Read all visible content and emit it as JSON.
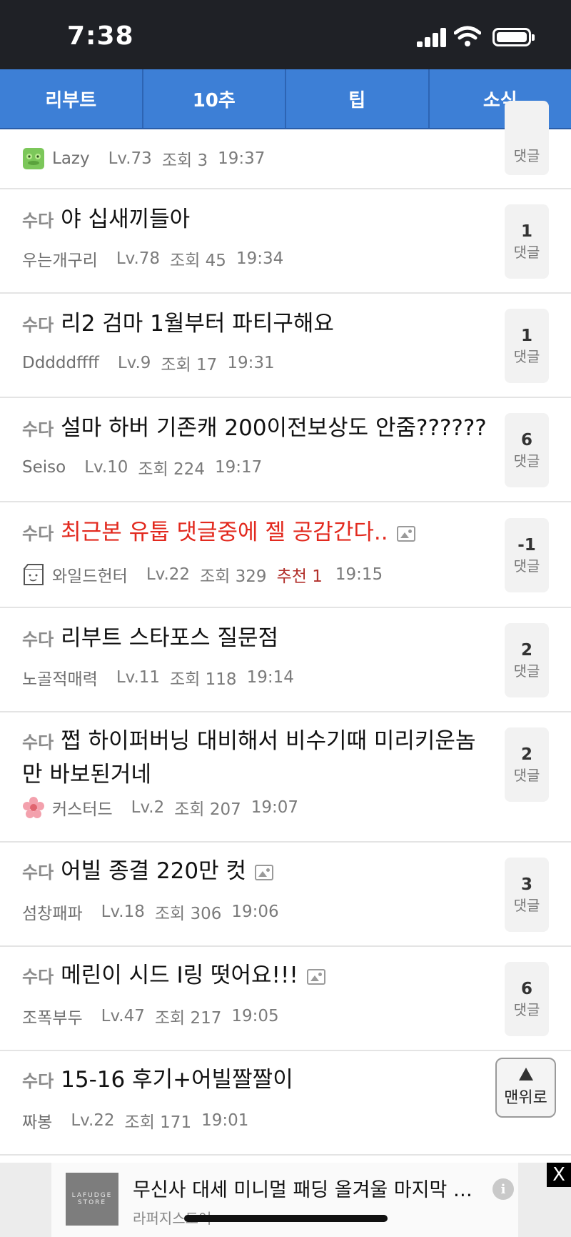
{
  "status": {
    "time": "7:38"
  },
  "tabs": [
    "리부트",
    "10추",
    "팁",
    "소식"
  ],
  "comment_label": "댓글",
  "posts": [
    {
      "author": "Lazy",
      "level": "Lv.73",
      "views": "조회 3",
      "time": "19:37"
    },
    {
      "prefix": "수다",
      "title": "야 십새끼들아",
      "author": "우는개구리",
      "level": "Lv.78",
      "views": "조회 45",
      "time": "19:34",
      "comments": "1"
    },
    {
      "prefix": "수다",
      "title": "리2 검마 1월부터 파티구해요",
      "author": "Dddddffff",
      "level": "Lv.9",
      "views": "조회 17",
      "time": "19:31",
      "comments": "1"
    },
    {
      "prefix": "수다",
      "title": "설마 하버 기존캐 200이전보상도 안줌??????",
      "author": "Seiso",
      "level": "Lv.10",
      "views": "조회 224",
      "time": "19:17",
      "comments": "6"
    },
    {
      "prefix": "수다",
      "title": "최근본 유툽 댓글중에 젤 공감간다..",
      "author": "와일드헌터",
      "level": "Lv.22",
      "views": "조회 329",
      "recommend": "추천 1",
      "time": "19:15",
      "comments": "-1"
    },
    {
      "prefix": "수다",
      "title": "리부트 스타포스 질문점",
      "author": "노골적매력",
      "level": "Lv.11",
      "views": "조회 118",
      "time": "19:14",
      "comments": "2"
    },
    {
      "prefix": "수다",
      "title": "쩝 하이퍼버닝 대비해서 비수기때 미리키운놈만 바보된거네",
      "author": "커스터드",
      "level": "Lv.2",
      "views": "조회 207",
      "time": "19:07",
      "comments": "2"
    },
    {
      "prefix": "수다",
      "title": "어빌 종결 220만 컷",
      "author": "섬창패파",
      "level": "Lv.18",
      "views": "조회 306",
      "time": "19:06",
      "comments": "3"
    },
    {
      "prefix": "수다",
      "title": "메린이 시드 I링 떳어요!!!",
      "author": "조폭부두",
      "level": "Lv.47",
      "views": "조회 217",
      "time": "19:05",
      "comments": "6"
    },
    {
      "prefix": "수다",
      "title": "15-16 후기+어빌짤짤이",
      "author": "짜봉",
      "level": "Lv.22",
      "views": "조회 171",
      "time": "19:01"
    }
  ],
  "scroll_top": {
    "label": "맨위로"
  },
  "ad": {
    "logo_text": "LAFUDGE STORE",
    "title": "무신사 대세 미니멀 패딩 올겨울 마지막 …",
    "subtitle": "라퍼지스토어",
    "info": "i",
    "close": "X"
  },
  "colors": {
    "tab_bg": "#3d7fd6",
    "title_highlight": "#e2291e",
    "recommend": "#b2302b"
  },
  "icons": [
    "signal-icon",
    "wifi-icon",
    "battery-icon",
    "image-icon",
    "frog-avatar-icon",
    "box-avatar-icon",
    "flower-avatar-icon",
    "arrow-up-icon",
    "info-icon",
    "close-icon"
  ]
}
